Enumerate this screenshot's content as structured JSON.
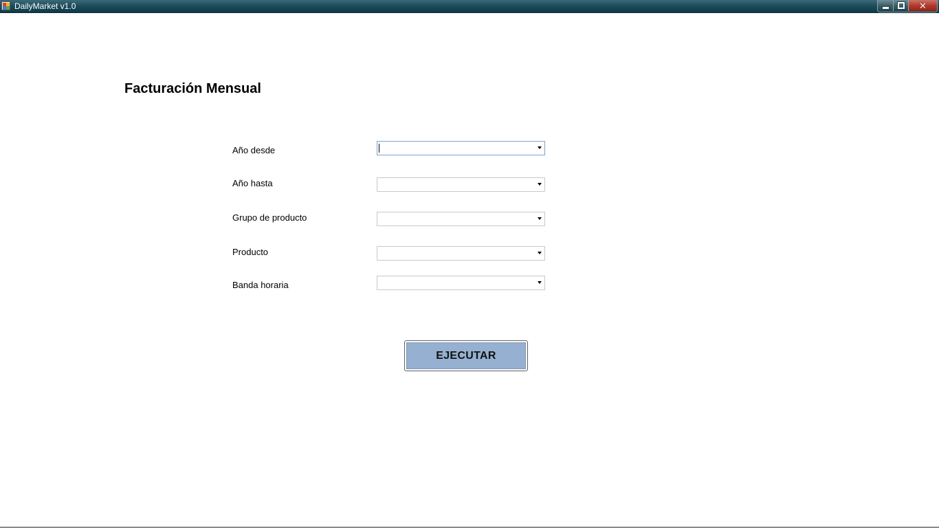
{
  "window": {
    "title": "DailyMarket v1.0",
    "icon": "app-icon",
    "buttons": {
      "minimize": "minimize-icon",
      "maximize": "restore-icon",
      "close": "close-icon",
      "close_glyph": "✕"
    }
  },
  "page": {
    "title": "Facturación Mensual"
  },
  "form": {
    "fields": [
      {
        "label": "Año desde",
        "value": ""
      },
      {
        "label": "Año hasta",
        "value": ""
      },
      {
        "label": "Grupo de producto",
        "value": ""
      },
      {
        "label": "Producto",
        "value": ""
      },
      {
        "label": "Banda horaria",
        "value": ""
      }
    ]
  },
  "actions": {
    "execute_label": "EJECUTAR"
  },
  "colors": {
    "titlebar": "#1e4d5c",
    "button_fill": "#95b0d0",
    "focus_border": "#7da2ce"
  }
}
